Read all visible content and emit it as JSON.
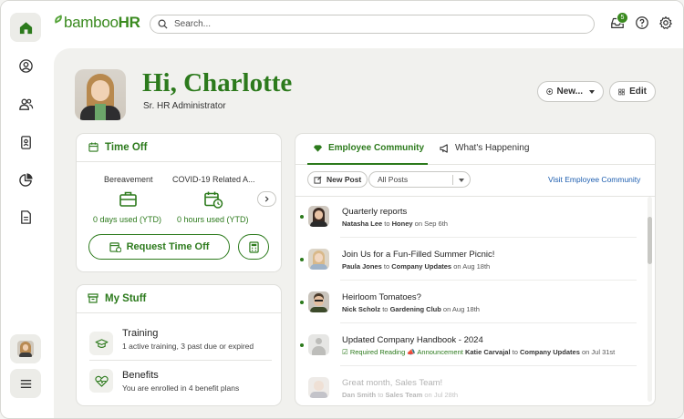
{
  "app": {
    "logo_text_1": "bamboo",
    "logo_text_2": "HR",
    "search_placeholder": "Search...",
    "inbox_count": "5",
    "accent_color": "#2c7a1c"
  },
  "sidebar": {
    "items": [
      {
        "icon": "home-icon",
        "active": true
      },
      {
        "icon": "user-circle-icon",
        "active": false
      },
      {
        "icon": "people-icon",
        "active": false
      },
      {
        "icon": "id-badge-icon",
        "active": false
      },
      {
        "icon": "pie-chart-icon",
        "active": false
      },
      {
        "icon": "document-icon",
        "active": false
      }
    ],
    "bottom": [
      "avatar",
      "menu-icon"
    ]
  },
  "header": {
    "greeting": "Hi, Charlotte",
    "role": "Sr. HR Administrator",
    "new_label": "New...",
    "edit_label": "Edit"
  },
  "time_off": {
    "title": "Time Off",
    "categories": [
      {
        "name": "Bereavement",
        "used": "0 days used (YTD)",
        "icon": "briefcase-icon"
      },
      {
        "name": "COVID-19 Related A...",
        "used": "0 hours used (YTD)",
        "icon": "calendar-clock-icon"
      }
    ],
    "request_label": "Request Time Off"
  },
  "my_stuff": {
    "title": "My Stuff",
    "items": [
      {
        "title": "Training",
        "subtitle": "1 active training, 3 past due or expired",
        "icon": "graduation-cap-icon"
      },
      {
        "title": "Benefits",
        "subtitle": "You are enrolled in 4 benefit plans",
        "icon": "heart-pulse-icon"
      }
    ]
  },
  "community": {
    "tabs": [
      {
        "label": "Employee Community",
        "active": true
      },
      {
        "label": "What's Happening",
        "active": false
      }
    ],
    "new_post_label": "New Post",
    "filter_value": "All Posts",
    "visit_link": "Visit Employee Community",
    "posts": [
      {
        "title": "Quarterly reports",
        "author": "Natasha Lee",
        "to_word": "to",
        "group": "Honey",
        "on_word": "on",
        "date": "Sep 6th"
      },
      {
        "title": "Join Us for a Fun-Filled Summer Picnic!",
        "author": "Paula Jones",
        "to_word": "to",
        "group": "Company Updates",
        "on_word": "on",
        "date": "Aug 18th"
      },
      {
        "title": "Heirloom Tomatoes?",
        "author": "Nick Scholz",
        "to_word": "to",
        "group": "Gardening Club",
        "on_word": "on",
        "date": "Aug 18th"
      },
      {
        "title": "Updated Company Handbook - 2024",
        "tag1": "Required Reading",
        "tag2": "Announcement",
        "author": "Katie Carvajal",
        "to_word": "to",
        "group": "Company Updates",
        "on_word": "on",
        "date": "Jul 31st"
      },
      {
        "title": "Great month, Sales Team!",
        "author": "Dan Smith",
        "to_word": "to",
        "group": "Sales Team",
        "on_word": "on",
        "date": "Jul 28th"
      }
    ]
  }
}
